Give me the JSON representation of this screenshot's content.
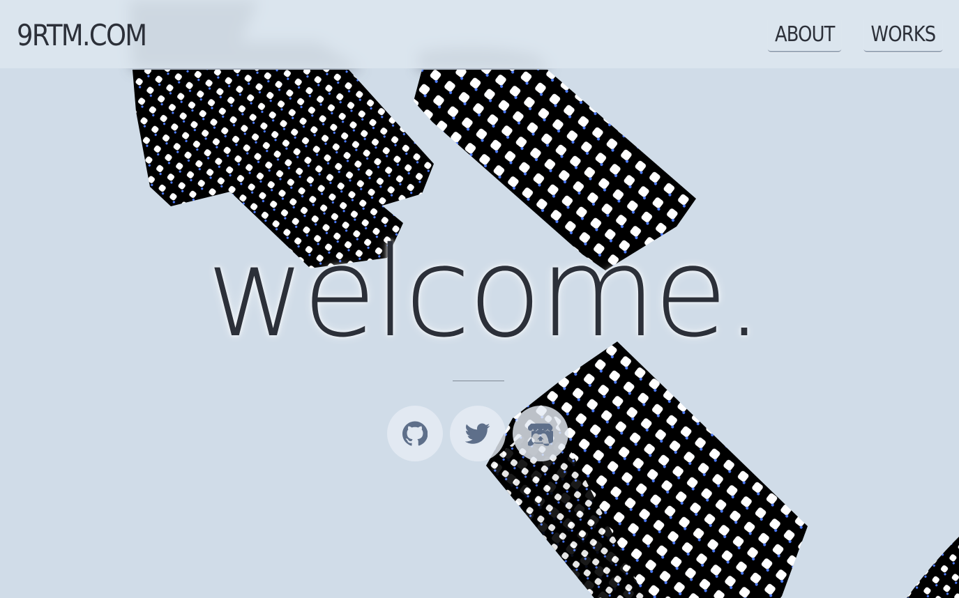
{
  "header": {
    "logo": "9RTM.COM",
    "nav": [
      {
        "label": "ABOUT"
      },
      {
        "label": "WORKS"
      }
    ]
  },
  "hero": {
    "title": "welcome."
  },
  "socials": [
    {
      "icon": "github-icon"
    },
    {
      "icon": "twitter-icon"
    },
    {
      "icon": "itchio-icon"
    }
  ],
  "colors": {
    "background": "#d0dce8",
    "header_background": "#dde6ef",
    "text": "#2c3039",
    "icon": "#5e6f8a",
    "halftone_dot": "#ffffff",
    "halftone_fill": "#000000"
  }
}
